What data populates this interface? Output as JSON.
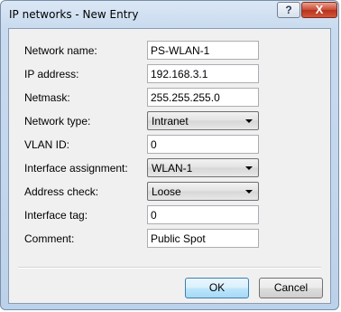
{
  "window": {
    "title": "IP networks - New Entry"
  },
  "titlebar_buttons": {
    "help": "?",
    "close": "X"
  },
  "form": [
    {
      "label": "Network name:",
      "type": "text",
      "value": "PS-WLAN-1"
    },
    {
      "label": "IP address:",
      "type": "text",
      "value": "192.168.3.1"
    },
    {
      "label": "Netmask:",
      "type": "text",
      "value": "255.255.255.0"
    },
    {
      "label": "Network type:",
      "type": "select",
      "value": "Intranet"
    },
    {
      "label": "VLAN ID:",
      "type": "text",
      "value": "0"
    },
    {
      "label": "Interface assignment:",
      "type": "select",
      "value": "WLAN-1"
    },
    {
      "label": "Address check:",
      "type": "select",
      "value": "Loose"
    },
    {
      "label": "Interface tag:",
      "type": "text",
      "value": "0"
    },
    {
      "label": "Comment:",
      "type": "text",
      "value": "Public Spot"
    }
  ],
  "buttons": {
    "ok": "OK",
    "cancel": "Cancel"
  }
}
